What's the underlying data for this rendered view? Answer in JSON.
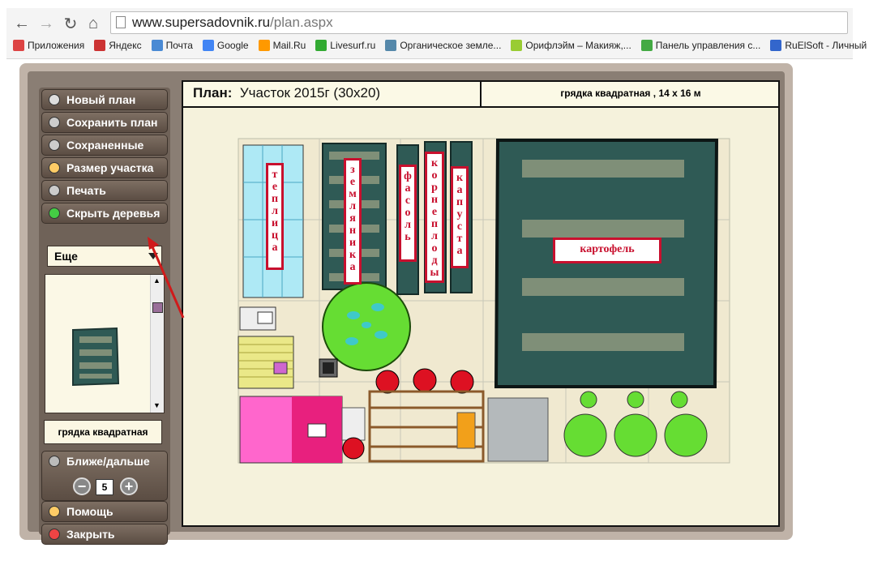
{
  "browser": {
    "url_host": "www.supersadovnik.ru",
    "url_path": "/plan.aspx",
    "bookmarks": [
      {
        "label": "Приложения",
        "icon": "apps-icon",
        "color": "#d44"
      },
      {
        "label": "Яндекс",
        "icon": "yandex-icon",
        "color": "#c33"
      },
      {
        "label": "Почта",
        "icon": "mail-icon",
        "color": "#4a8ad4"
      },
      {
        "label": "Google",
        "icon": "google-icon",
        "color": "#4285f4"
      },
      {
        "label": "Mail.Ru",
        "icon": "mailru-icon",
        "color": "#f90"
      },
      {
        "label": "Livesurf.ru",
        "icon": "livesurf-icon",
        "color": "#3a3"
      },
      {
        "label": "Органическое земле...",
        "icon": "organic-icon",
        "color": "#58a"
      },
      {
        "label": "Орифлэйм – Макияж,...",
        "icon": "oriflame-icon",
        "color": "#9c3"
      },
      {
        "label": "Панель управления с...",
        "icon": "puzzle-icon",
        "color": "#4a4"
      },
      {
        "label": "RuElSoft - Личный ка...",
        "icon": "ruelsoft-icon",
        "color": "#36c"
      }
    ]
  },
  "sidebar": {
    "buttons_top": [
      {
        "label": "Новый план",
        "icon": "new-plan-icon",
        "color": "#ddd"
      },
      {
        "label": "Сохранить план",
        "icon": "lock-icon",
        "color": "#ccc"
      },
      {
        "label": "Сохраненные",
        "icon": "folder-icon",
        "color": "#ccc"
      },
      {
        "label": "Размер участка",
        "icon": "size-icon",
        "color": "#fc6"
      },
      {
        "label": "Печать",
        "icon": "print-icon",
        "color": "#ccc"
      },
      {
        "label": "Скрыть деревья",
        "icon": "tree-icon",
        "color": "#4c4"
      }
    ],
    "select_value": "Еще",
    "selected_name": "грядка квадратная",
    "zoom_label": "Ближе/дальше",
    "zoom_value": "5",
    "buttons_bottom": [
      {
        "label": "Помощь",
        "icon": "help-icon",
        "color": "#fc6"
      },
      {
        "label": "Закрыть",
        "icon": "close-icon",
        "color": "#e44"
      }
    ]
  },
  "plan": {
    "title_label": "План:",
    "title_value": "Участок 2015г (30x20)",
    "selection_info": "грядка квадратная ,  14 x 16 м",
    "labels": {
      "greenhouse": "теплица",
      "strawberry": "земляника",
      "beans": "фасоль",
      "roots": "корнеплоды",
      "cabbage": "капуста",
      "potato": "картофель"
    }
  },
  "colors": {
    "bed": "#2f5a55",
    "bed_stripe": "#7f8f78",
    "label_border": "#c8102e",
    "canvas_bg": "#f5f2dc",
    "tree_green": "#66dd33"
  }
}
